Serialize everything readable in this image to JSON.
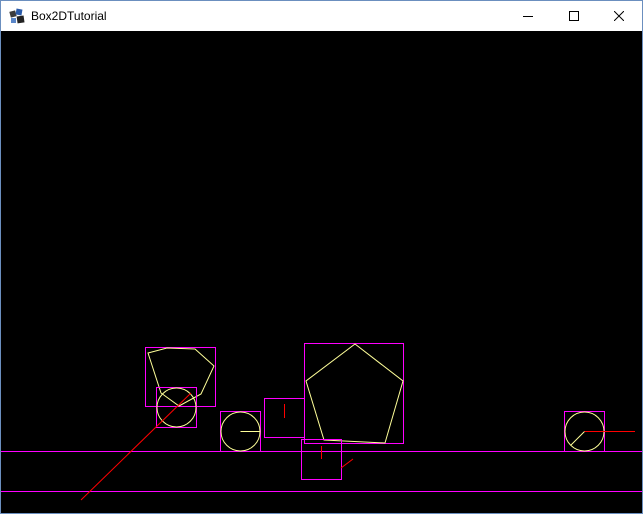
{
  "window": {
    "title": "Box2DTutorial",
    "controls": {
      "minimize_icon": "minimize-icon",
      "maximize_icon": "maximize-icon",
      "close_icon": "close-icon"
    }
  },
  "scene": {
    "background": "#000000",
    "colors": {
      "aabb": "#ff00ff",
      "shape": "#ffff99",
      "pair": "#ff0000"
    }
  }
}
